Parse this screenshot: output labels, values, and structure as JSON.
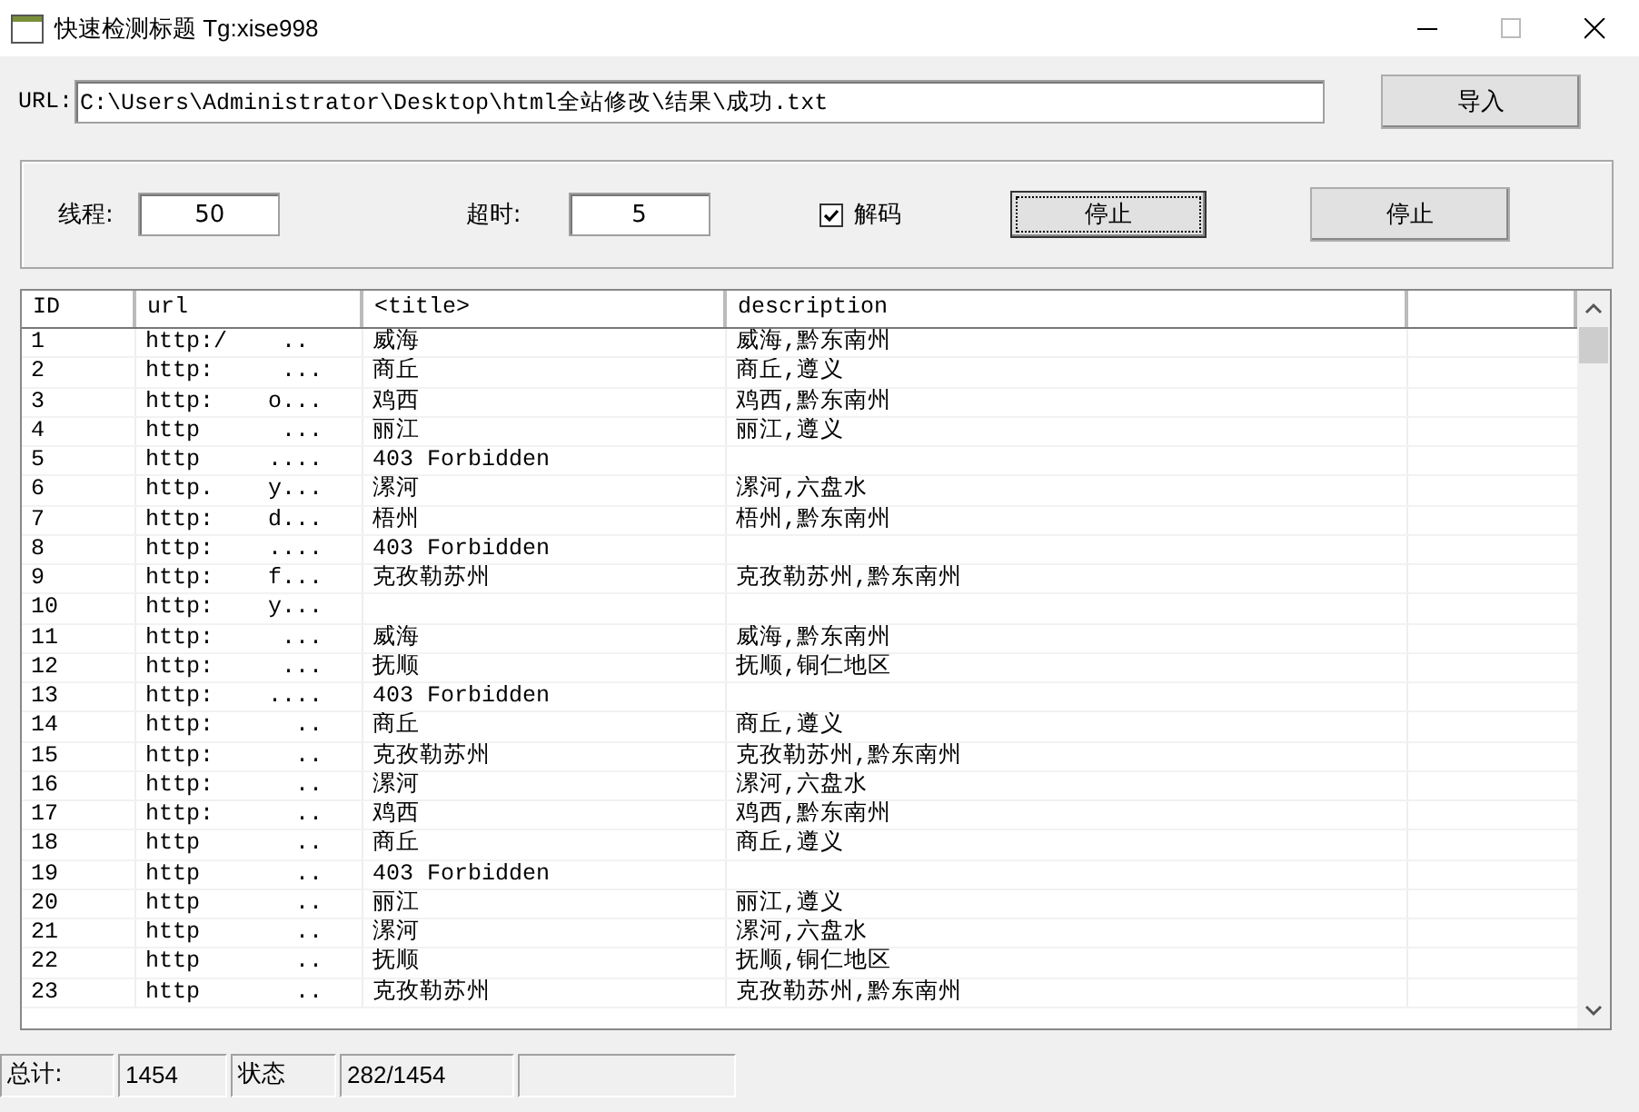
{
  "window": {
    "title": "快速检测标题 Tg:xise998"
  },
  "url_bar": {
    "label": "URL:",
    "value": "C:\\Users\\Administrator\\Desktop\\html全站修改\\结果\\成功.txt",
    "button": "导入"
  },
  "options": {
    "threads_label": "线程:",
    "threads": "50",
    "timeout_label": "超时:",
    "timeout": "5",
    "decode": {
      "label": "解码",
      "checked": true
    },
    "buttons": [
      {
        "label": "停止",
        "focused": true
      },
      {
        "label": "停止",
        "focused": false
      }
    ]
  },
  "table": {
    "columns": [
      "ID",
      "url",
      "<title>",
      "description"
    ],
    "rows": [
      {
        "id": "1",
        "url": "http:/    ..",
        "title": "威海",
        "description": "威海,黔东南州"
      },
      {
        "id": "2",
        "url": "http:     ...",
        "title": "商丘",
        "description": "商丘,遵义"
      },
      {
        "id": "3",
        "url": "http:    o...",
        "title": "鸡西",
        "description": "鸡西,黔东南州"
      },
      {
        "id": "4",
        "url": "http      ...",
        "title": "丽江",
        "description": "丽江,遵义"
      },
      {
        "id": "5",
        "url": "http     ....",
        "title": "403 Forbidden",
        "description": ""
      },
      {
        "id": "6",
        "url": "http.    y...",
        "title": "漯河",
        "description": "漯河,六盘水"
      },
      {
        "id": "7",
        "url": "http:    d...",
        "title": "梧州",
        "description": "梧州,黔东南州"
      },
      {
        "id": "8",
        "url": "http:    ....",
        "title": "403 Forbidden",
        "description": ""
      },
      {
        "id": "9",
        "url": "http:    f...",
        "title": "克孜勒苏州",
        "description": "克孜勒苏州,黔东南州"
      },
      {
        "id": "10",
        "url": "http:    y...",
        "title": "",
        "description": ""
      },
      {
        "id": "11",
        "url": "http:     ...",
        "title": "威海",
        "description": "威海,黔东南州"
      },
      {
        "id": "12",
        "url": "http:     ...",
        "title": "抚顺",
        "description": "抚顺,铜仁地区"
      },
      {
        "id": "13",
        "url": "http:    ....",
        "title": "403 Forbidden",
        "description": ""
      },
      {
        "id": "14",
        "url": "http:      ..",
        "title": "商丘",
        "description": "商丘,遵义"
      },
      {
        "id": "15",
        "url": "http:      ..",
        "title": "克孜勒苏州",
        "description": "克孜勒苏州,黔东南州"
      },
      {
        "id": "16",
        "url": "http:      ..",
        "title": "漯河",
        "description": "漯河,六盘水"
      },
      {
        "id": "17",
        "url": "http:      ..",
        "title": "鸡西",
        "description": "鸡西,黔东南州"
      },
      {
        "id": "18",
        "url": "http       ..",
        "title": "商丘",
        "description": "商丘,遵义"
      },
      {
        "id": "19",
        "url": "http       ..",
        "title": "403 Forbidden",
        "description": ""
      },
      {
        "id": "20",
        "url": "http       ..",
        "title": "丽江",
        "description": "丽江,遵义"
      },
      {
        "id": "21",
        "url": "http       ..",
        "title": "漯河",
        "description": "漯河,六盘水"
      },
      {
        "id": "22",
        "url": "http       ..",
        "title": "抚顺",
        "description": "抚顺,铜仁地区"
      },
      {
        "id": "23",
        "url": "http       ..",
        "title": "克孜勒苏州",
        "description": "克孜勒苏州,黔东南州"
      }
    ]
  },
  "status_bar": [
    "总计:",
    "1454",
    "状态",
    "282/1454"
  ]
}
